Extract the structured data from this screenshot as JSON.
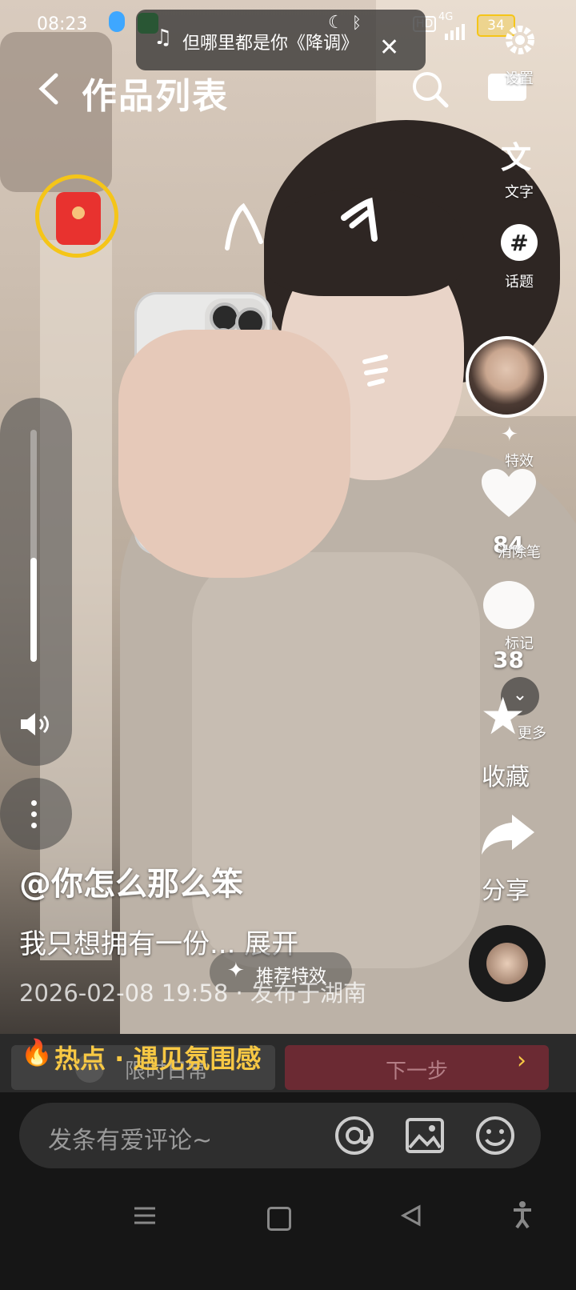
{
  "status_bar": {
    "time": "08:23",
    "hd": "HD",
    "network": "4G",
    "battery": "34"
  },
  "music": {
    "title": "但哪里都是你《降调》"
  },
  "header": {
    "title": "作品列表",
    "settings_label": "设置"
  },
  "right_tools": {
    "text_label": "文字",
    "text_glyph": "文",
    "topic_label": "话题",
    "effects_label": "特效",
    "eraser_label": "消除笔",
    "mark_label": "标记",
    "more_label": "更多"
  },
  "engagement": {
    "likes": "84",
    "comments": "38",
    "favorite_label": "收藏",
    "share_label": "分享"
  },
  "post": {
    "author": "@你怎么那么笨",
    "caption": "我只想拥有一份...",
    "expand_label": "展开",
    "meta": "2026-02-08 19:58 · 发布于湖南",
    "recommend_effect": "推荐特效"
  },
  "hot": {
    "label": "热点 · 遇见氛围感",
    "limited_label": "限时日常",
    "next_label": "下一步"
  },
  "comment": {
    "placeholder": "发条有爱评论~"
  },
  "colors": {
    "hot_yellow": "#f7c844",
    "redpacket": "#e8322f",
    "ring": "#f5c518",
    "next_bg": "#6b2a33"
  }
}
